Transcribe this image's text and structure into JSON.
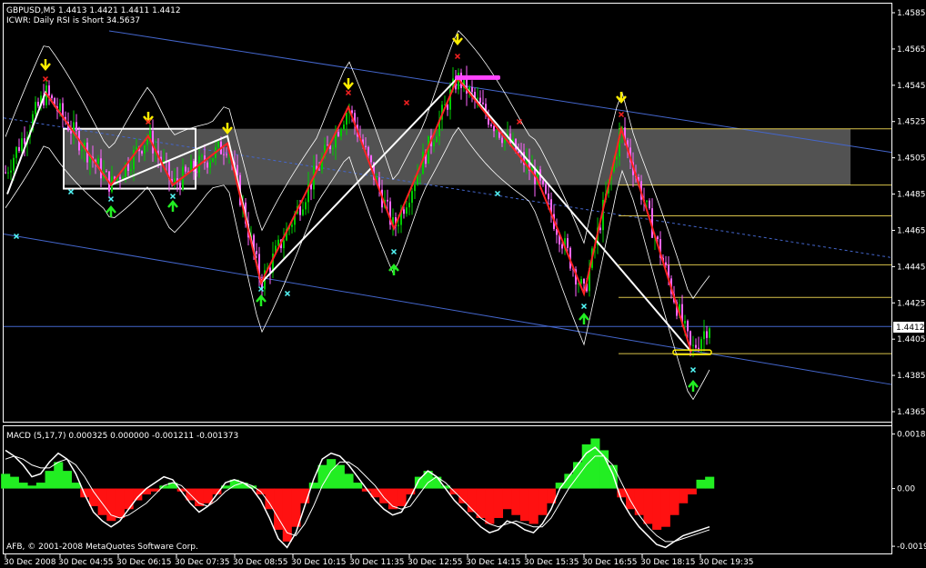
{
  "header": {
    "symbol_line": "GBPUSD,M5  1.4413 1.4421 1.4411 1.4412",
    "indicator_line": "ICWR: Daily RSI is Short 34.5637"
  },
  "macd_header": "MACD  (5,17,7) 0.000325 0.000000 -0.001211 -0.001373",
  "copyright": "AFB, © 2001-2008 MetaQuotes Software Corp.",
  "current_price_label": "1.4412",
  "colors": {
    "background": "#000000",
    "bull_candle": "#00cc00",
    "bear_candle": "#ff66ff",
    "zigzag_white": "#ffffff",
    "zigzag_red": "#ff2222",
    "channel_blue": "#4466cc",
    "fib_line": "#d8c24a",
    "zone_fill": "#6e6e6e",
    "macd_pos": "#22ee22",
    "macd_neg": "#ff1111",
    "arrow_down": "#ffee00",
    "arrow_up": "#22ee22",
    "cross_red": "#ff2222",
    "cross_cyan": "#55ffff",
    "highlight_magenta": "#ff44ff"
  },
  "chart_data": [
    {
      "type": "line",
      "title": "GBPUSD,M5",
      "price_ticks": [
        "1.4585",
        "1.4565",
        "1.4545",
        "1.4525",
        "1.4505",
        "1.4485",
        "1.4465",
        "1.4445",
        "1.4425",
        "1.4405",
        "1.4385",
        "1.4365"
      ],
      "ylim": [
        1.4359,
        1.4589
      ],
      "time_ticks": [
        "30 Dec 2008",
        "30 Dec 04:55",
        "30 Dec 06:15",
        "30 Dec 07:35",
        "30 Dec 08:55",
        "30 Dec 10:15",
        "30 Dec 11:35",
        "30 Dec 12:55",
        "30 Dec 14:15",
        "30 Dec 15:35",
        "30 Dec 16:55",
        "30 Dec 18:15",
        "30 Dec 19:35"
      ],
      "current_price": 1.4412,
      "zigzag_white": [
        1.4485,
        1.4541,
        1.449,
        1.4517,
        1.4436,
        1.4549,
        1.4398
      ],
      "zigzag_red": [
        1.4541,
        1.449,
        1.4517,
        1.449,
        1.4513,
        1.4436,
        1.4533,
        1.4466,
        1.4549,
        1.4494,
        1.443,
        1.4521,
        1.4398
      ],
      "fib_levels": [
        1.4521,
        1.449,
        1.4473,
        1.4446,
        1.4428,
        1.4397
      ],
      "channel_upper": [
        1.4575,
        1.4508
      ],
      "channel_mid": [
        1.4527,
        1.445
      ],
      "channel_lower": [
        1.4463,
        1.438
      ],
      "zone": [
        1.4521,
        1.449
      ]
    },
    {
      "type": "bar",
      "title": "MACD  (5,17,7)",
      "ticks": [
        "0.00185",
        "0.00",
        "-0.00196"
      ],
      "ylim": [
        -0.00205,
        0.0019
      ],
      "values": [
        0.0005,
        0.0004,
        0.0002,
        0.0001,
        0.0002,
        0.0006,
        0.0009,
        0.0006,
        0.0002,
        -0.0003,
        -0.0006,
        -0.0009,
        -0.0011,
        -0.001,
        -0.0007,
        -0.0004,
        -0.0002,
        -0.0001,
        0.0001,
        0.0002,
        -0.0001,
        -0.0004,
        -0.0006,
        -0.0005,
        -0.0002,
        0.0001,
        0.0003,
        0.0002,
        0.0001,
        -0.0002,
        -0.0007,
        -0.0014,
        -0.0018,
        -0.0013,
        -0.0005,
        0.0002,
        0.0008,
        0.001,
        0.0008,
        0.0005,
        0.0002,
        -0.0001,
        -0.0003,
        -0.0005,
        -0.0007,
        -0.0006,
        -0.0002,
        0.0004,
        0.0006,
        0.0004,
        0.0001,
        -0.0002,
        -0.0005,
        -0.0008,
        -0.001,
        -0.0012,
        -0.001,
        -0.0007,
        -0.0009,
        -0.0011,
        -0.0012,
        -0.0009,
        -0.0005,
        0.0002,
        0.0005,
        0.0009,
        0.0015,
        0.0017,
        0.0013,
        0.0008,
        -0.0003,
        -0.0007,
        -0.0009,
        -0.0012,
        -0.0014,
        -0.0013,
        -0.0009,
        -0.0005,
        -0.0002,
        0.0003,
        0.0004
      ],
      "macd_line": [
        0.0013,
        0.0011,
        0.0008,
        0.0004,
        0.0005,
        0.0009,
        0.0012,
        0.001,
        0.0005,
        -0.0002,
        -0.0008,
        -0.0011,
        -0.0013,
        -0.0011,
        -0.0007,
        -0.0003,
        0.0,
        0.0002,
        0.0004,
        0.0003,
        -0.0001,
        -0.0005,
        -0.0008,
        -0.0006,
        -0.0002,
        0.0002,
        0.0003,
        0.0002,
        0.0,
        -0.0004,
        -0.001,
        -0.0017,
        -0.002,
        -0.0015,
        -0.0006,
        0.0003,
        0.001,
        0.0012,
        0.0011,
        0.0008,
        0.0004,
        0.0,
        -0.0004,
        -0.0007,
        -0.0009,
        -0.0008,
        -0.0003,
        0.0003,
        0.0006,
        0.0004,
        0.0,
        -0.0004,
        -0.0007,
        -0.001,
        -0.0013,
        -0.0015,
        -0.0014,
        -0.0011,
        -0.0012,
        -0.0014,
        -0.0015,
        -0.0012,
        -0.0007,
        0.0,
        0.0004,
        0.0008,
        0.0012,
        0.0014,
        0.0011,
        0.0005,
        -0.0004,
        -0.0009,
        -0.0013,
        -0.0016,
        -0.0019,
        -0.002,
        -0.0018,
        -0.0016,
        -0.0015,
        -0.0014,
        -0.0013
      ],
      "signal_line": [
        0.001,
        0.0011,
        0.001,
        0.0008,
        0.0007,
        0.0007,
        0.0009,
        0.001,
        0.0008,
        0.0004,
        -0.0001,
        -0.0005,
        -0.0009,
        -0.001,
        -0.0009,
        -0.0007,
        -0.0005,
        -0.0002,
        0.0001,
        0.0002,
        0.0001,
        -0.0002,
        -0.0005,
        -0.0006,
        -0.0004,
        -0.0001,
        0.0001,
        0.0002,
        0.0001,
        -0.0001,
        -0.0005,
        -0.001,
        -0.0015,
        -0.0016,
        -0.0012,
        -0.0006,
        0.0001,
        0.0006,
        0.0009,
        0.0009,
        0.0007,
        0.0004,
        0.0001,
        -0.0003,
        -0.0006,
        -0.0007,
        -0.0006,
        -0.0002,
        0.0002,
        0.0004,
        0.0002,
        -0.0001,
        -0.0004,
        -0.0007,
        -0.001,
        -0.0012,
        -0.0013,
        -0.0012,
        -0.0011,
        -0.0012,
        -0.0013,
        -0.0013,
        -0.001,
        -0.0005,
        0.0,
        0.0004,
        0.0008,
        0.0011,
        0.0011,
        0.0008,
        0.0002,
        -0.0004,
        -0.0009,
        -0.0013,
        -0.0016,
        -0.0018,
        -0.0018,
        -0.0017,
        -0.0016,
        -0.0015,
        -0.0014
      ]
    }
  ]
}
